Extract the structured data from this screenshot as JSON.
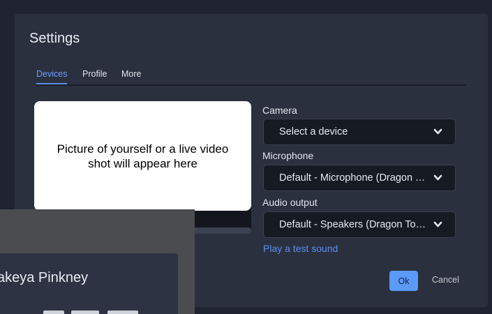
{
  "dialog": {
    "title": "Settings",
    "tabs": [
      {
        "label": "Devices",
        "active": true
      },
      {
        "label": "Profile",
        "active": false
      },
      {
        "label": "More",
        "active": false
      }
    ]
  },
  "preview": {
    "placeholder_text": "Picture of yourself or a live video shot will appear here"
  },
  "devices": {
    "camera": {
      "label": "Camera",
      "value": "Select a device"
    },
    "microphone": {
      "label": "Microphone",
      "value": "Default - Microphone (Dragon Touch)"
    },
    "audio_output": {
      "label": "Audio output",
      "value": "Default - Speakers (Dragon Touch)"
    },
    "test_sound_label": "Play a test sound"
  },
  "actions": {
    "ok_label": "Ok",
    "cancel_label": "Cancel"
  },
  "overlay": {
    "participant_name": "akeya Pinkney"
  },
  "colors": {
    "accent": "#5b9af7",
    "link": "#5b8ff2",
    "dialog_bg": "#2b303e",
    "page_bg": "#1f2430"
  },
  "icons": {
    "select_indicator": "chevron-down-icon"
  }
}
